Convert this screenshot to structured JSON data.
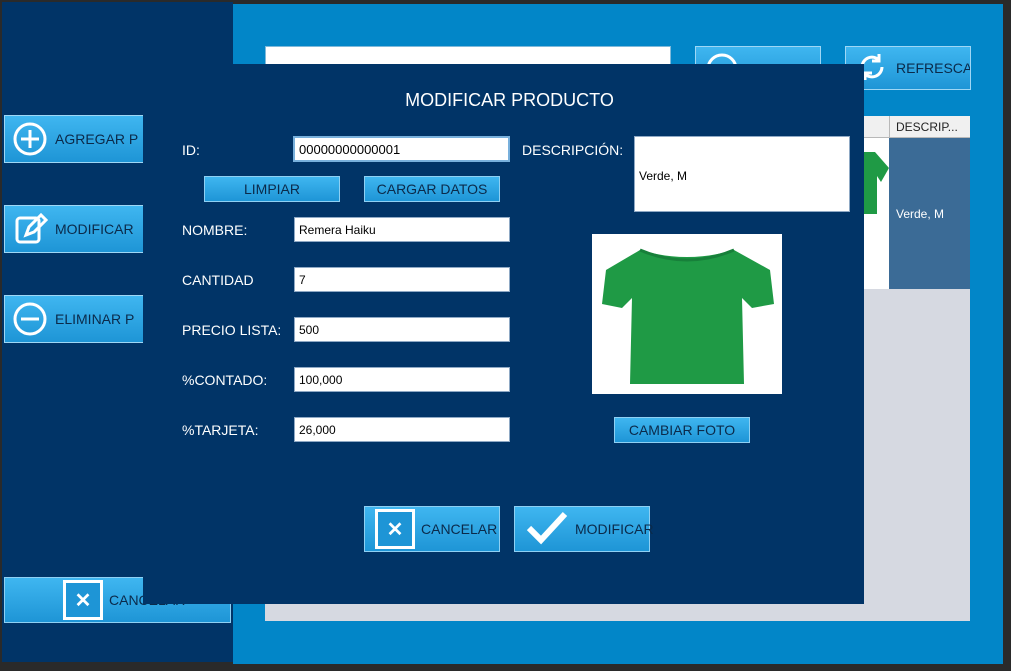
{
  "left_panel": {
    "buttons": [
      {
        "label": "AGREGAR P",
        "icon": "plus-circle-icon"
      },
      {
        "label": "MODIFICAR",
        "icon": "edit-icon"
      },
      {
        "label": "ELIMINAR P",
        "icon": "minus-circle-icon"
      }
    ],
    "cancel_label": "CANCELAR"
  },
  "toolbar": {
    "search_value": "",
    "refresh_label": "REFRESCAR"
  },
  "table": {
    "desc_header": "DESCRIP...",
    "row_desc": "Verde, M"
  },
  "dialog": {
    "title": "MODIFICAR PRODUCTO",
    "id_label": "ID:",
    "id_value": "00000000000001",
    "clear_label": "LIMPIAR",
    "load_label": "CARGAR DATOS",
    "name_label": "NOMBRE:",
    "name_value": "Remera Haiku",
    "qty_label": "CANTIDAD",
    "qty_value": "7",
    "price_label": "PRECIO LISTA:",
    "price_value": "500",
    "cash_label": "%CONTADO:",
    "cash_value": "100,000",
    "card_label": "%TARJETA:",
    "card_value": "26,000",
    "desc_label": "DESCRIPCIÓN:",
    "desc_value": "Verde, M",
    "change_photo_label": "CAMBIAR FOTO",
    "cancel_label": "CANCELAR",
    "modify_label": "MODIFICAR"
  },
  "colors": {
    "dialog_bg": "#013467",
    "accent": "#1e95d6",
    "shirt": "#1f9a45"
  }
}
